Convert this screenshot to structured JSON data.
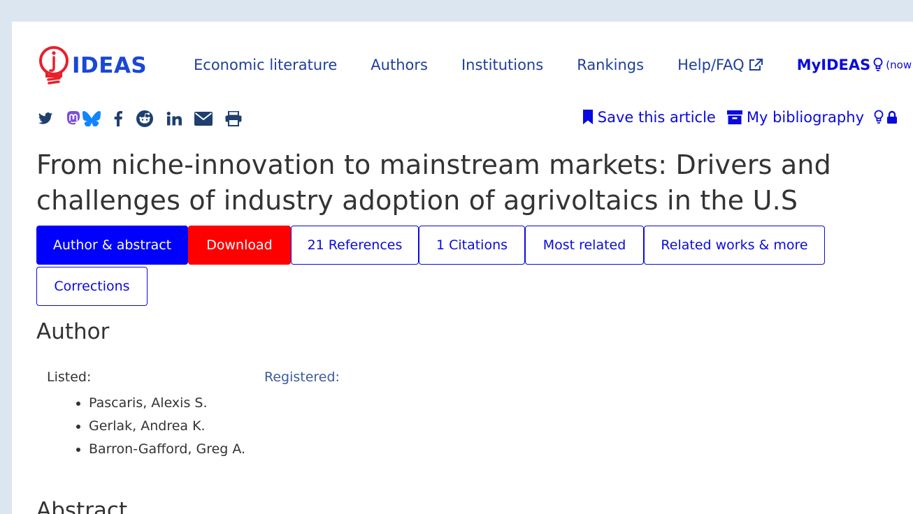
{
  "logo": {
    "text": "IDEAS"
  },
  "nav": {
    "items": [
      "Economic literature",
      "Authors",
      "Institutions",
      "Rankings",
      "Help/FAQ"
    ],
    "myideas": "MyIDEAS",
    "myideas_note": "(now"
  },
  "social": [
    "twitter-icon",
    "mastodon-icon",
    "bluesky-icon",
    "facebook-icon",
    "reddit-icon",
    "linkedin-icon",
    "email-icon",
    "print-icon"
  ],
  "actions": {
    "save": "Save this article",
    "bibliography": "My bibliography"
  },
  "article": {
    "title": "From niche-innovation to mainstream markets: Drivers and challenges of industry adoption of agrivoltaics in the U.S"
  },
  "tabs": [
    "Author & abstract",
    "Download",
    "21 References",
    "1 Citations",
    "Most related",
    "Related works & more",
    "Corrections"
  ],
  "author_section": {
    "heading": "Author",
    "listed_label": "Listed:",
    "registered_label": "Registered:",
    "authors": [
      "Pascaris, Alexis S.",
      "Gerlak, Andrea K.",
      "Barron-Gafford, Greg A."
    ]
  },
  "abstract_heading": "Abstract",
  "colors": {
    "accent": "#0000ff",
    "download": "#ff0000",
    "nav": "#1f3f99",
    "logo": "#1a47d6"
  }
}
